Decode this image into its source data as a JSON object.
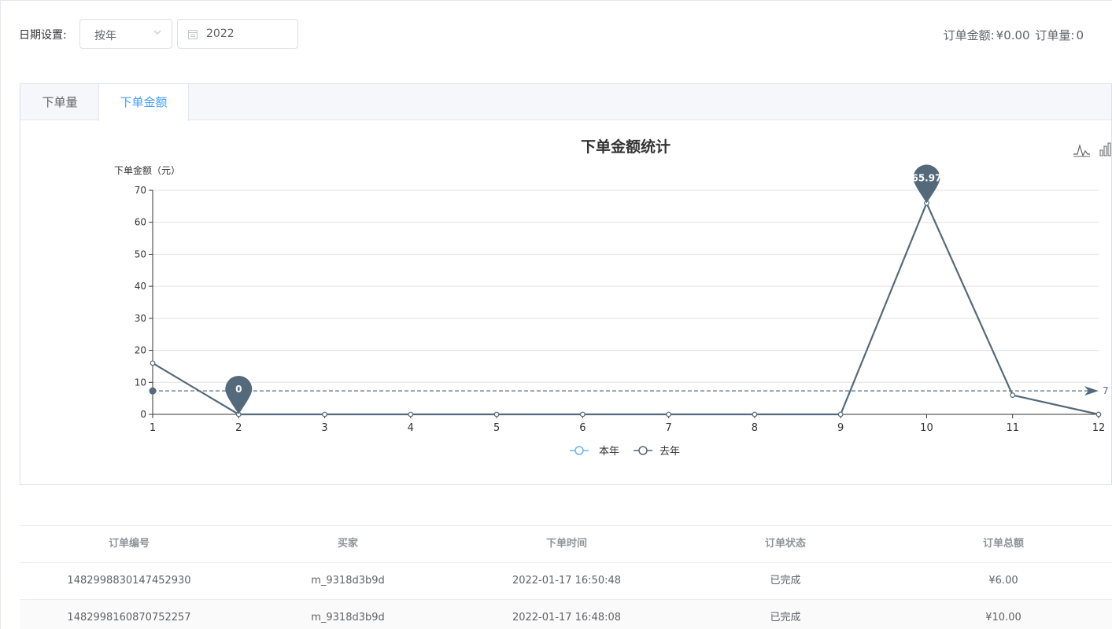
{
  "toolbar": {
    "date_label": "日期设置:",
    "period_select": "按年",
    "year_value": "2022",
    "order_amount_label": "订单金额:",
    "order_amount_value": "¥0.00",
    "order_count_label": "订单量:",
    "order_count_value": "0"
  },
  "tabs": [
    {
      "label": "下单量",
      "active": false
    },
    {
      "label": "下单金额",
      "active": true
    }
  ],
  "icons": {
    "line_toggle": "line-chart-icon",
    "bar_toggle": "bar-chart-icon",
    "calendar": "calendar-icon",
    "dropdown": "chevron-down-icon"
  },
  "colors": {
    "active_tab": "#409eff",
    "series_this_year": "#546a7b",
    "legend_this_year": "#6fb3f0",
    "legend_last_year": "#546a7b"
  },
  "chart_data": {
    "type": "line",
    "title": "下单金额统计",
    "ylabel": "下单金额（元）",
    "xlabel": "",
    "ylim": [
      0,
      70
    ],
    "yticks": [
      0,
      10,
      20,
      30,
      40,
      50,
      60,
      70
    ],
    "x": [
      1,
      2,
      3,
      4,
      5,
      6,
      7,
      8,
      9,
      10,
      11,
      12
    ],
    "series": [
      {
        "name": "本年",
        "values": [
          16,
          0,
          0,
          0,
          0,
          0,
          0,
          0,
          0,
          65.97,
          6,
          0
        ]
      }
    ],
    "legend": [
      "本年",
      "去年"
    ],
    "legend_position": "bottom",
    "mark_points": [
      {
        "label": "0",
        "x": 2,
        "y": 0
      },
      {
        "label": "65.97",
        "x": 10,
        "y": 65.97
      }
    ],
    "mark_line": {
      "label": "7",
      "y": 7.33
    },
    "grid": true
  },
  "table": {
    "headers": [
      "订单编号",
      "买家",
      "下单时间",
      "订单状态",
      "订单总额"
    ],
    "rows": [
      [
        "1482998830147452930",
        "m_9318d3b9d",
        "2022-01-17 16:50:48",
        "已完成",
        "¥6.00"
      ],
      [
        "1482998160870752257",
        "m_9318d3b9d",
        "2022-01-17 16:48:08",
        "已完成",
        "¥10.00"
      ]
    ]
  }
}
